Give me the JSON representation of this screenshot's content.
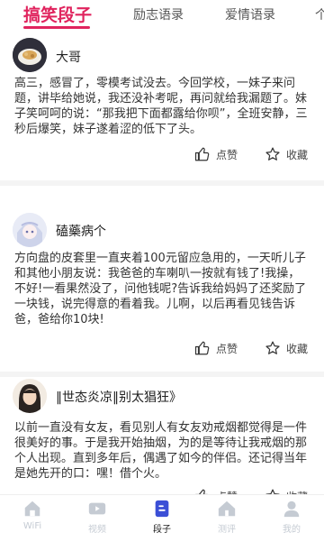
{
  "tabs": [
    {
      "label": "搞笑段子",
      "active": true
    },
    {
      "label": "励志语录",
      "active": false
    },
    {
      "label": "爱情语录",
      "active": false
    },
    {
      "label": "个",
      "active": false
    }
  ],
  "posts": [
    {
      "author": "大哥",
      "content": "高三，感冒了，零模考试没去。今回学校，一妹子来问题，讲毕给她说，我还没补考呢，再问就给我漏题了。妹子笑呵呵的说：“那我把下面都露给你呗”，全班安静，三秒后爆笑，妹子遂着涩的低下了头。",
      "like_label": "点赞",
      "fav_label": "收藏"
    },
    {
      "author": "磕藥病个",
      "content": "方向盘的皮套里一直夹着100元留应急用的，一天听儿子和其他小朋友说：我爸爸的车喇叭一按就有钱了!我操，不好!一看果然没了，问他钱呢?告诉我给妈妈了还奖励了一块钱，说完得意的看着我。儿啊，以后再看见钱告诉爸，爸给你10块!",
      "like_label": "点赞",
      "fav_label": "收藏"
    },
    {
      "author": "‖世态炎凉‖别太猖狂》",
      "content": "以前一直没有女友，看见别人有女友劝戒烟都觉得是一件很美好的事。于是我开始抽烟，为的是等待让我戒烟的那个人出现。直到多年后，偶遇了如今的伴侣。还记得当年是她先开的口：嘿！借个火。",
      "like_label": "点赞",
      "fav_label": "收藏"
    }
  ],
  "bottom_nav": [
    {
      "label": "WiFi",
      "active": false
    },
    {
      "label": "视频",
      "active": false
    },
    {
      "label": "段子",
      "active": true
    },
    {
      "label": "测评",
      "active": false
    },
    {
      "label": "我的",
      "active": false
    }
  ],
  "colors": {
    "accent": "#e0245e",
    "nav_active": "#3b4fd6",
    "nav_inactive": "#c5cbd3"
  }
}
